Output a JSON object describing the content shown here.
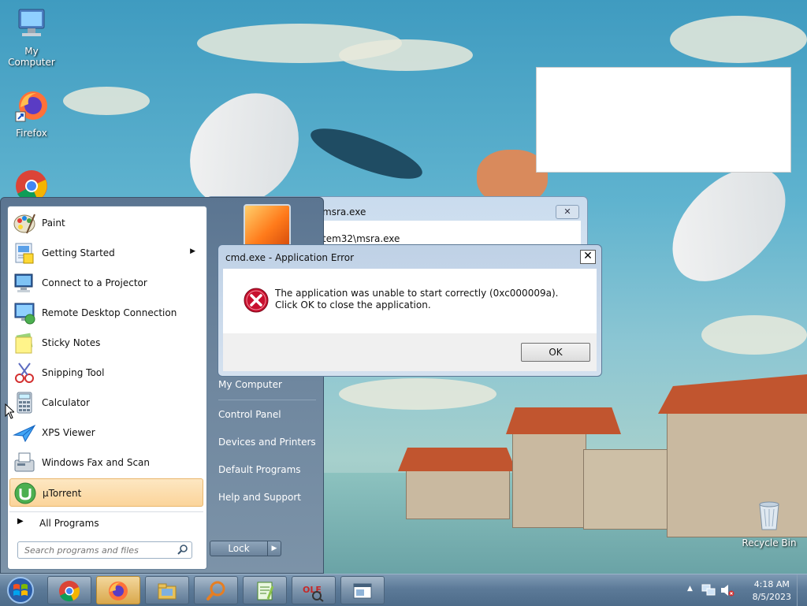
{
  "desktop": {
    "icons": [
      {
        "label": "My Computer"
      },
      {
        "label": "Firefox"
      },
      {
        "label": "Google Chrome"
      },
      {
        "label": "Recycle Bin"
      }
    ]
  },
  "behind_window": {
    "title_fragment": "msra.exe",
    "path_fragment": "tem32\\msra.exe",
    "close_glyph": "✕"
  },
  "start_menu": {
    "programs": [
      {
        "label": "Paint",
        "icon": "paint-icon"
      },
      {
        "label": "Getting Started",
        "icon": "getting-started-icon",
        "has_submenu": true
      },
      {
        "label": "Connect to a Projector",
        "icon": "projector-icon"
      },
      {
        "label": "Remote Desktop Connection",
        "icon": "remote-desktop-icon"
      },
      {
        "label": "Sticky Notes",
        "icon": "sticky-notes-icon"
      },
      {
        "label": "Snipping Tool",
        "icon": "snipping-tool-icon"
      },
      {
        "label": "Calculator",
        "icon": "calculator-icon"
      },
      {
        "label": "XPS Viewer",
        "icon": "xps-viewer-icon"
      },
      {
        "label": "Windows Fax and Scan",
        "icon": "fax-scan-icon"
      },
      {
        "label": "µTorrent",
        "icon": "utorrent-icon",
        "selected": true
      }
    ],
    "all_programs": "All Programs",
    "search_placeholder": "Search programs and files",
    "right_links": [
      {
        "label": "My Computer"
      },
      {
        "label": "Control Panel"
      },
      {
        "label": "Devices and Printers"
      },
      {
        "label": "Default Programs"
      },
      {
        "label": "Help and Support"
      }
    ],
    "lock_label": "Lock",
    "lock_arrow": "▶"
  },
  "dialog": {
    "title": "cmd.exe - Application Error",
    "close_glyph": "✕",
    "message": "The application was unable to start correctly (0xc000009a). Click OK to close the application.",
    "ok_label": "OK"
  },
  "taskbar": {
    "pinned": [
      "chrome-icon",
      "firefox-icon",
      "file-explorer-icon",
      "search-magnifier-icon",
      "notepad-plus-icon",
      "ole-app-icon",
      "app-window-icon"
    ],
    "time": "4:18 AM",
    "date": "8/5/2023"
  },
  "colors": {
    "selection": "#fbd49a",
    "error_red": "#c8102e",
    "taskbar": "#5c7a98"
  }
}
